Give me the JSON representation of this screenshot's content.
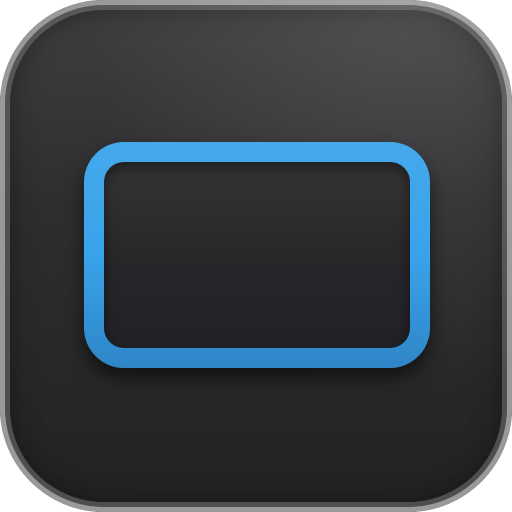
{
  "icon": {
    "name": "window-outline-icon",
    "background_color": "#2e2e30",
    "accent_color": "#39a3ea"
  }
}
